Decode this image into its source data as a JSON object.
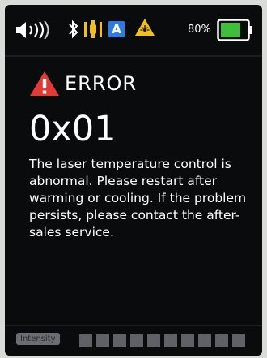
{
  "status_bar": {
    "icons": [
      "speaker-volume-icon",
      "bluetooth-icon",
      "light-icon",
      "auto-mode-icon",
      "laser-warning-icon"
    ],
    "auto_label": "A",
    "battery_percent": "80%",
    "battery_level": 0.8,
    "battery_color": "#3dbf3c"
  },
  "error": {
    "title": "ERROR",
    "code": "0x01",
    "message": "The laser temperature control is abnormal. Please restart after warming or cooling. If the problem persists, please contact the after-sales service.",
    "accent_color": "#e53935"
  },
  "footer": {
    "intensity_label": "Intensity",
    "intensity_level": 0
  }
}
